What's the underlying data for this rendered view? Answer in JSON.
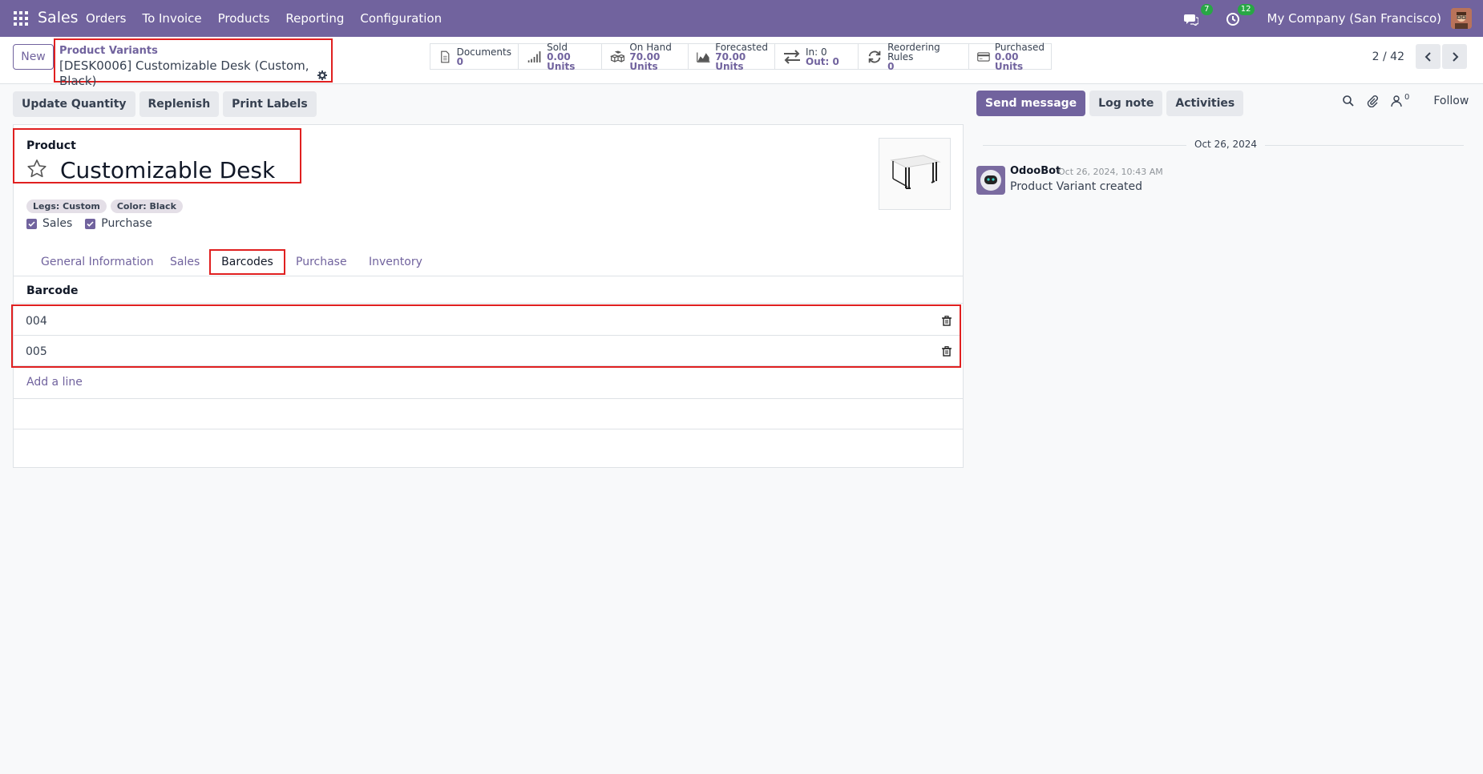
{
  "navbar": {
    "app_name": "Sales",
    "menu": [
      "Orders",
      "To Invoice",
      "Products",
      "Reporting",
      "Configuration"
    ],
    "messages_badge": "7",
    "activities_badge": "12",
    "company": "My Company (San Francisco)"
  },
  "control": {
    "new_label": "New",
    "breadcrumb_parent": "Product Variants",
    "breadcrumb_current": "[DESK0006] Customizable Desk (Custom, Black)",
    "stats": [
      {
        "label": "Documents",
        "value": "0",
        "icon": "document-icon"
      },
      {
        "label": "Sold",
        "value": "0.00 Units",
        "icon": "signal-bars-icon"
      },
      {
        "label": "On Hand",
        "value": "70.00 Units",
        "icon": "cubes-icon"
      },
      {
        "label": "Forecasted",
        "value": "70.00 Units",
        "icon": "area-chart-icon"
      },
      {
        "label": "In: 0",
        "value": "Out: 0",
        "icon": "exchange-icon"
      },
      {
        "label": "Reordering Rules",
        "value": "0",
        "icon": "refresh-icon"
      },
      {
        "label": "Purchased",
        "value": "0.00 Units",
        "icon": "credit-card-icon"
      }
    ],
    "pager": "2 / 42"
  },
  "actions": {
    "update_quantity": "Update Quantity",
    "replenish": "Replenish",
    "print_labels": "Print Labels"
  },
  "form": {
    "title_label": "Product",
    "product_name": "Customizable Desk",
    "tags": [
      "Legs: Custom",
      "Color: Black"
    ],
    "sales_label": "Sales",
    "purchase_label": "Purchase",
    "tabs": [
      "General Information",
      "Sales",
      "Barcodes",
      "Purchase",
      "Inventory"
    ],
    "active_tab": "Barcodes",
    "barcode_header": "Barcode",
    "barcodes": [
      "004",
      "005"
    ],
    "add_line": "Add a line"
  },
  "chatter": {
    "send_message": "Send message",
    "log_note": "Log note",
    "activities": "Activities",
    "follower_count": "0",
    "follow": "Follow",
    "date": "Oct 26, 2024",
    "author": "OdooBot",
    "msg_date": "Oct 26, 2024, 10:43 AM",
    "body": "Product Variant created"
  },
  "colors": {
    "brand": "#71639e",
    "highlight": "#e02020",
    "badge": "#28a745"
  }
}
